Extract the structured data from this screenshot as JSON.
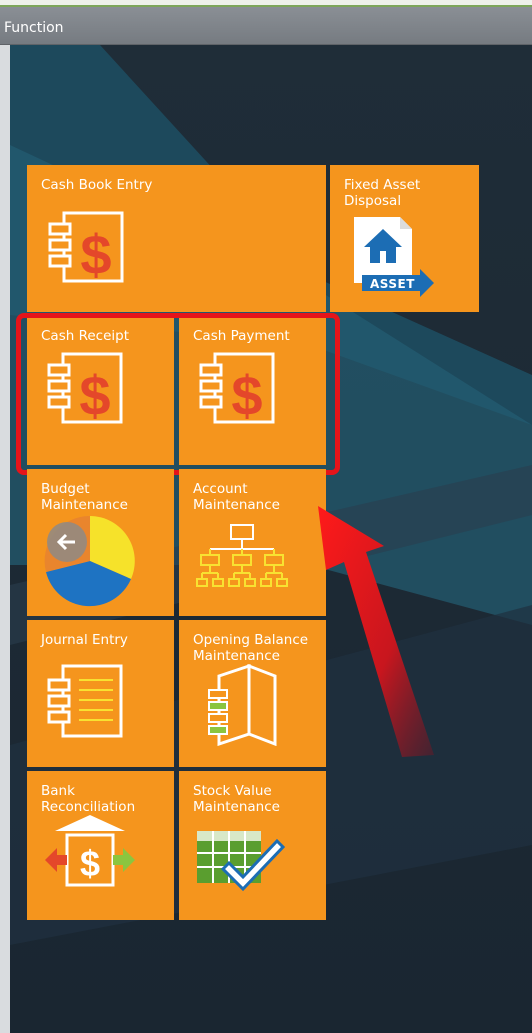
{
  "window": {
    "title": "Function"
  },
  "tiles": [
    {
      "id": "cash-book-entry",
      "label": "Cash Book Entry",
      "icon": "cash-book-icon"
    },
    {
      "id": "fixed-asset-disposal",
      "label": "Fixed Asset\nDisposal",
      "icon": "asset-disposal-icon",
      "badge": "ASSET"
    },
    {
      "id": "cash-receipt",
      "label": "Cash Receipt",
      "icon": "cash-book-icon"
    },
    {
      "id": "cash-payment",
      "label": "Cash Payment",
      "icon": "cash-book-icon"
    },
    {
      "id": "budget-maintenance",
      "label": "Budget\nMaintenance",
      "icon": "pie-chart-icon"
    },
    {
      "id": "account-maintenance",
      "label": "Account\nMaintenance",
      "icon": "org-chart-icon"
    },
    {
      "id": "journal-entry",
      "label": "Journal Entry",
      "icon": "journal-icon"
    },
    {
      "id": "opening-balance-maintenance",
      "label": "Opening Balance\nMaintenance",
      "icon": "folded-book-icon"
    },
    {
      "id": "bank-reconciliation",
      "label": "Bank\nReconciliation",
      "icon": "bank-reconcile-icon"
    },
    {
      "id": "stock-value-maintenance",
      "label": "Stock Value\nMaintenance",
      "icon": "stock-sheet-icon"
    }
  ],
  "colors": {
    "tile": "#f5951d",
    "highlight": "#e5141a",
    "arrow": "#d8151c"
  }
}
